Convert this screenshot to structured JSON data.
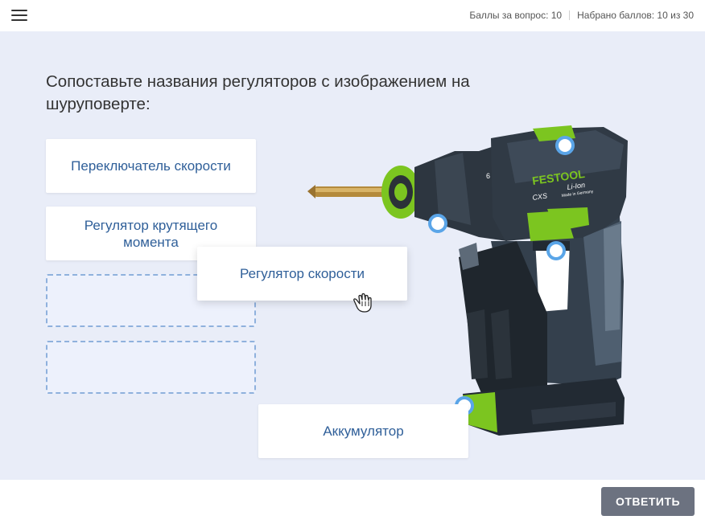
{
  "header": {
    "points_per_question": "Баллы за вопрос: 10",
    "total_score": "Набрано баллов: 10 из 30"
  },
  "question": {
    "text": "Сопоставьте названия регуляторов с изображением на шуруповерте:"
  },
  "options": [
    {
      "label": "Переключатель скорости"
    },
    {
      "label": "Регулятор крутящего момента"
    },
    {
      "label": "Регулятор скорости"
    },
    {
      "label": "Аккумулятор"
    }
  ],
  "drill": {
    "brand": "FESTOOL",
    "badge": "Li-Ion",
    "model": "CXS",
    "made_in": "Made in Germany",
    "chuck_mark": "6"
  },
  "footer": {
    "submit_label": "ОТВЕТИТЬ"
  },
  "colors": {
    "accent_green": "#7cc520",
    "hotspot_blue": "#5aa5e8",
    "card_text": "#2f5f99",
    "submit_bg": "#6c7280"
  }
}
